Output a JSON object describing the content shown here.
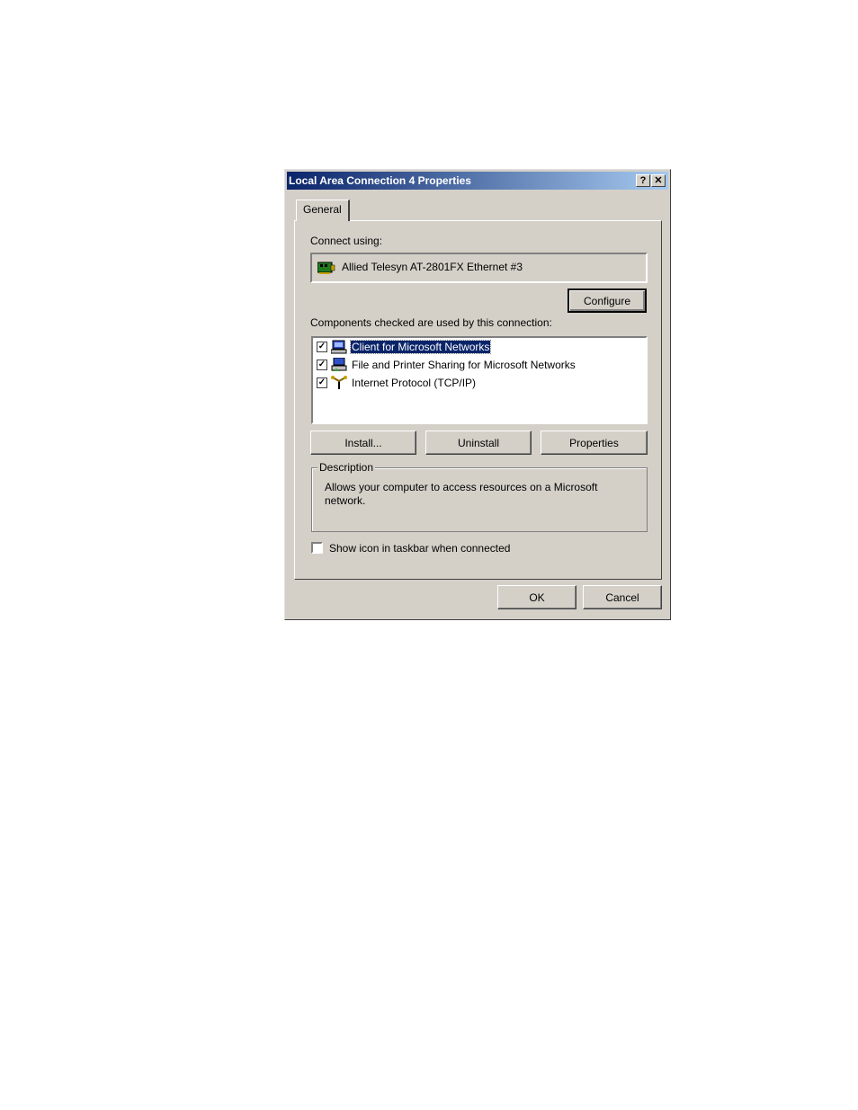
{
  "window": {
    "title": "Local Area Connection 4 Properties",
    "help_button": "?",
    "close_button": "✕"
  },
  "tabs": [
    {
      "label": "General"
    }
  ],
  "connect_using": {
    "label": "Connect using:",
    "adapter": "Allied Telesyn AT-2801FX Ethernet #3",
    "configure_button": "Configure"
  },
  "components": {
    "label": "Components checked are used by this connection:",
    "items": [
      {
        "label": "Client for Microsoft Networks",
        "checked": true,
        "selected": true,
        "icon": "network-client-icon"
      },
      {
        "label": "File and Printer Sharing for Microsoft Networks",
        "checked": true,
        "selected": false,
        "icon": "file-printer-sharing-icon"
      },
      {
        "label": "Internet Protocol (TCP/IP)",
        "checked": true,
        "selected": false,
        "icon": "network-protocol-icon"
      }
    ]
  },
  "buttons": {
    "install": "Install...",
    "uninstall": "Uninstall",
    "properties": "Properties",
    "ok": "OK",
    "cancel": "Cancel"
  },
  "description": {
    "title": "Description",
    "text": "Allows your computer to access resources on a Microsoft network."
  },
  "show_icon": {
    "label": "Show icon in taskbar when connected",
    "checked": false
  },
  "colors": {
    "dialog_bg": "#d4d0c8",
    "titlebar_start": "#0a246a",
    "titlebar_end": "#a6caf0",
    "selection": "#0a246a"
  }
}
